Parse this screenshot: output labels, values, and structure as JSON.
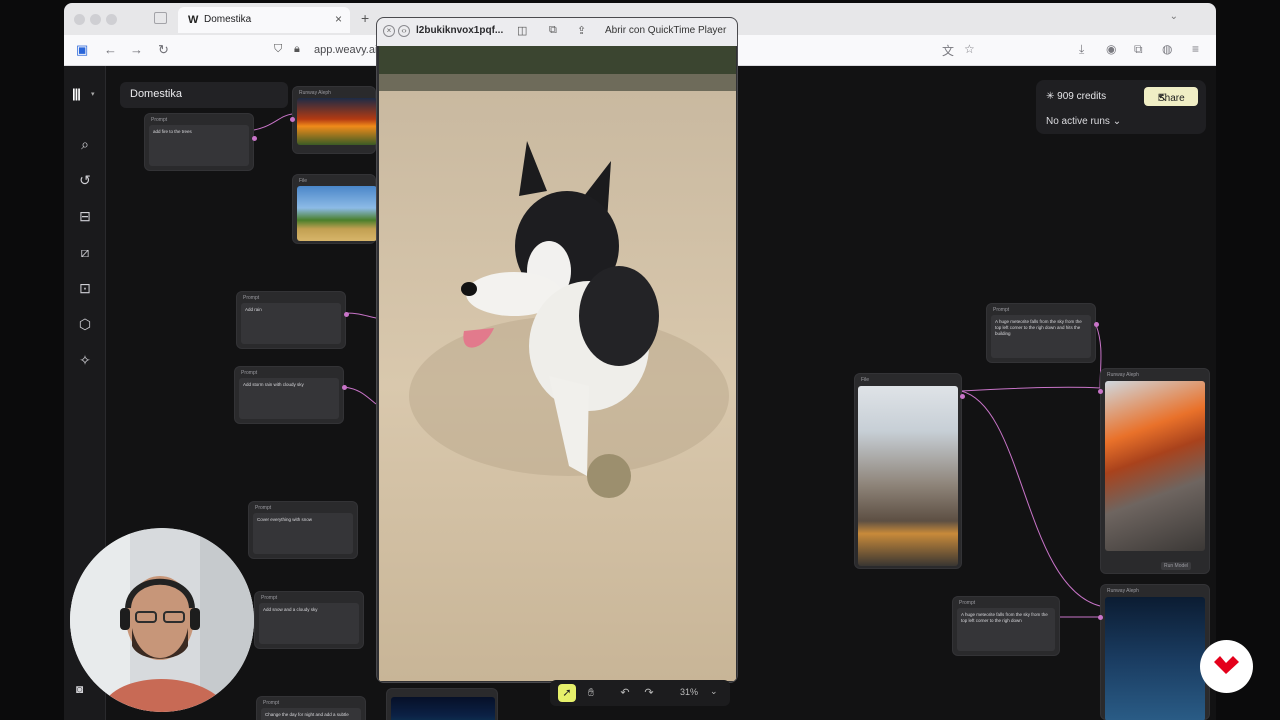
{
  "browser": {
    "tab_title": "Domestika",
    "tab_favicon": "W",
    "tab_close": "×",
    "new_tab": "+",
    "url": "app.weavy.ai"
  },
  "app": {
    "project_name": "Domestika",
    "credits": "909 credits",
    "share_label": "Share",
    "active_runs": "No active runs"
  },
  "nodes": {
    "prompt_fire": "add fire to the trees",
    "prompt_rain": "Add rain",
    "prompt_storm": "Add storm rain with cloudy sky",
    "prompt_cover": "Cover everything with snow",
    "prompt_snow_sky": "Add snow and a cloudy sky",
    "prompt_night": "Change the day for night and add a subtle",
    "prompt_meteor_1": "A huge meteorite falls from the sky from the top left corner to the righ down and hits the building",
    "prompt_meteor_2": "A huge meteorite falls from the sky from the top left corner to the righ down",
    "header_prompt": "Prompt",
    "header_runway": "Runway Aleph",
    "header_file": "File",
    "run_model": "Run Model"
  },
  "quicktime": {
    "filename": "l2bukiknvox1pqf...",
    "open_with": "Abrir con QuickTime Player"
  },
  "toolbar": {
    "zoom": "31%"
  },
  "colors": {
    "canvas_bg": "#121213",
    "edge": "#c874c8",
    "share_bg": "#f0eec5",
    "domestika_red": "#e4001b"
  }
}
